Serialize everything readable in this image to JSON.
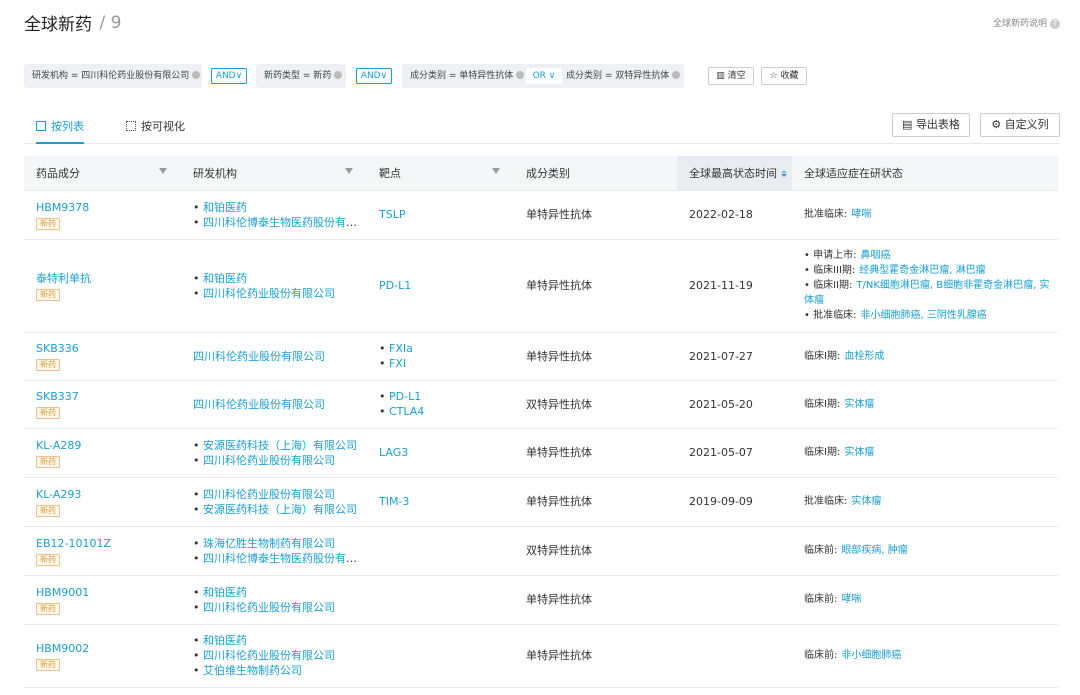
{
  "header": {
    "title": "全球新药",
    "count": "/ 9",
    "help": "全球新药说明"
  },
  "filters": {
    "chip1": "研发机构 = 四川科伦药业股份有限公司",
    "op1": "AND∨",
    "chip2": "新药类型 = 新药",
    "op2": "AND∨",
    "chip3a": "成分类别 = 单特异性抗体",
    "or": "OR ∨",
    "chip3b": "成分类别 = 双特异性抗体",
    "clear": "清空",
    "save": "收藏"
  },
  "tabs": {
    "list": "按列表",
    "visual": "按可视化",
    "export": "导出表格",
    "custom": "自定义列"
  },
  "columns": [
    "药品成分",
    "研发机构",
    "靶点",
    "成分类别",
    "全球最高状态时间",
    "全球适应症在研状态"
  ],
  "rows": [
    {
      "name": "HBM9378",
      "tag": "新药",
      "orgs": [
        "和铂医药",
        "四川科伦博泰生物医药股份有限..."
      ],
      "targets": [
        "TSLP"
      ],
      "cat": "单特异性抗体",
      "date": "2022-02-18",
      "status": [
        {
          "k": "批准临床:",
          "v": "哮喘"
        }
      ]
    },
    {
      "name": "泰特利单抗",
      "tag": "新药",
      "orgs": [
        "和铂医药",
        "四川科伦药业股份有限公司"
      ],
      "targets": [
        "PD-L1"
      ],
      "cat": "单特异性抗体",
      "date": "2021-11-19",
      "status": [
        {
          "k": "申请上市:",
          "v": "鼻咽癌"
        },
        {
          "k": "临床III期:",
          "v": "经典型霍奇金淋巴瘤, 淋巴瘤"
        },
        {
          "k": "临床II期:",
          "v": "T/NK细胞淋巴瘤, B细胞非霍奇金淋巴瘤, 实体瘤"
        },
        {
          "k": "批准临床:",
          "v": "非小细胞肺癌, 三阴性乳腺癌"
        }
      ]
    },
    {
      "name": "SKB336",
      "tag": "新药",
      "orgs": [
        "四川科伦药业股份有限公司"
      ],
      "targets": [
        "FXIa",
        "FXI"
      ],
      "cat": "单特异性抗体",
      "date": "2021-07-27",
      "status": [
        {
          "k": "临床I期:",
          "v": "血栓形成"
        }
      ]
    },
    {
      "name": "SKB337",
      "tag": "新药",
      "orgs": [
        "四川科伦药业股份有限公司"
      ],
      "targets": [
        "PD-L1",
        "CTLA4"
      ],
      "cat": "双特异性抗体",
      "date": "2021-05-20",
      "status": [
        {
          "k": "临床I期:",
          "v": "实体瘤"
        }
      ]
    },
    {
      "name": "KL-A289",
      "tag": "新药",
      "orgs": [
        "安源医药科技（上海）有限公司",
        "四川科伦药业股份有限公司"
      ],
      "targets": [
        "LAG3"
      ],
      "cat": "单特异性抗体",
      "date": "2021-05-07",
      "status": [
        {
          "k": "临床I期:",
          "v": "实体瘤"
        }
      ]
    },
    {
      "name": "KL-A293",
      "tag": "新药",
      "orgs": [
        "四川科伦药业股份有限公司",
        "安源医药科技（上海）有限公司"
      ],
      "targets": [
        "TIM-3"
      ],
      "cat": "单特异性抗体",
      "date": "2019-09-09",
      "status": [
        {
          "k": "批准临床:",
          "v": "实体瘤"
        }
      ]
    },
    {
      "name": "EB12-10101Z",
      "tag": "新药",
      "orgs": [
        "珠海亿胜生物制药有限公司",
        "四川科伦博泰生物医药股份有限..."
      ],
      "targets": [],
      "cat": "双特异性抗体",
      "date": "",
      "status": [
        {
          "k": "临床前:",
          "v": "眼部疾病, 肿瘤"
        }
      ]
    },
    {
      "name": "HBM9001",
      "tag": "新药",
      "orgs": [
        "和铂医药",
        "四川科伦药业股份有限公司"
      ],
      "targets": [],
      "cat": "单特异性抗体",
      "date": "",
      "status": [
        {
          "k": "临床前:",
          "v": "哮喘"
        }
      ]
    },
    {
      "name": "HBM9002",
      "tag": "新药",
      "orgs": [
        "和铂医药",
        "四川科伦药业股份有限公司",
        "艾伯维生物制药公司"
      ],
      "targets": [],
      "cat": "单特异性抗体",
      "date": "",
      "status": [
        {
          "k": "临床前:",
          "v": "非小细胞肺癌"
        }
      ]
    }
  ]
}
